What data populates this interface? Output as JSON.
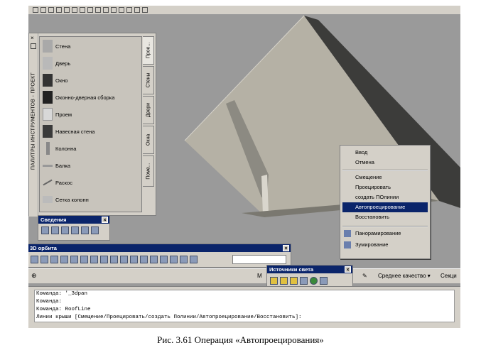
{
  "palette": {
    "title": "ПАЛИТРЫ ИНСТРУМЕНТОВ - ПРОЕКТ",
    "tools": [
      "Стена",
      "Дверь",
      "Окно",
      "Оконно-дверная сборка",
      "Проем",
      "Навесная стена",
      "Колонна",
      "Балка",
      "Раскос",
      "Сетка колонн"
    ],
    "tabs": [
      "Прое...",
      "Стены",
      "Двери",
      "Окна",
      "Поме..."
    ]
  },
  "svedeniya": {
    "title": "Сведения"
  },
  "orbit": {
    "title": "3D орбита",
    "partial_label": "М"
  },
  "lights": {
    "title": "Источники света"
  },
  "status": {
    "quality": "Среднее качество ▾",
    "section": "Секци"
  },
  "context_menu": {
    "items": [
      {
        "label": "Ввод",
        "highlighted": false
      },
      {
        "label": "Отмена",
        "highlighted": false
      },
      {
        "label": "Смещение",
        "highlighted": false
      },
      {
        "label": "Проецировать",
        "highlighted": false
      },
      {
        "label": "создать ПОлинии",
        "highlighted": false
      },
      {
        "label": "Автопроецирование",
        "highlighted": true
      },
      {
        "label": "Восстановить",
        "highlighted": false
      },
      {
        "label": "Панорамирование",
        "highlighted": false
      },
      {
        "label": "Зумирование",
        "highlighted": false
      }
    ]
  },
  "command_line": {
    "lines": [
      "Команда: '_3dpan",
      "Команда:",
      "Команда: RoofLine",
      "Линии крыши [Смещение/Проецировать/создать Полинии/Автопроецирование/Восстановить]:"
    ]
  },
  "caption": "Рис. 3.61 Операция «Автопроецирования»",
  "colors": {
    "highlight": "#0a246a",
    "panel": "#d4d0c8",
    "viewport": "#9a9a9a"
  }
}
